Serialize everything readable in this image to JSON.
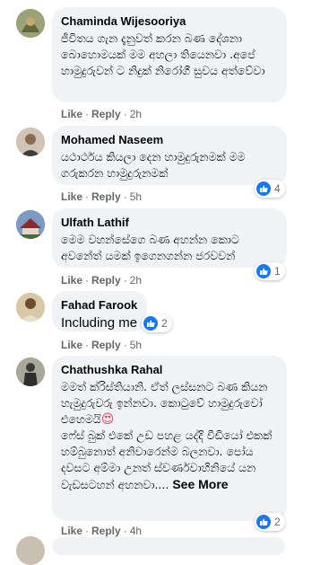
{
  "comments": [
    {
      "name": "Chaminda Wijesooriya",
      "text": "ජීවිතය ගැන දැනුවත් කරන බණ දේශනා බොහොමයක් මම අහලා තියෙනවා .අපේ හාමුදුරුවන් ට නිදුක් නිරෝගී සුවය අත්වේවා",
      "like": "Like",
      "reply": "Reply",
      "time": "2h",
      "reactions": ""
    },
    {
      "name": "Mohamed Naseem",
      "text": "යථාර්ථය කියලා දෙන හාමුදුරුනමක් මම ගරුකරන හාමුදුරුනමක්",
      "like": "Like",
      "reply": "Reply",
      "time": "5h",
      "reactions": "4"
    },
    {
      "name": "Ulfath Lathif",
      "text": "මෙම වහන්සේගෙ බණ අහන්න කොට අවනේත් යමක් ඉගෙනගන්න ජරවවන්",
      "like": "Like",
      "reply": "Reply",
      "time": "2h",
      "reactions": "1"
    },
    {
      "name": "Fahad Farook",
      "text": "Including me",
      "like": "Like",
      "reply": "Reply",
      "time": "5h",
      "reactions": "2"
    },
    {
      "name": "Chathushka Rahal",
      "text": "මමත් ක්රිස්තියානි. ඒත් ලස්සනට බණ කියන හැමුදුරුවරු ඉන්නවා. කොටුවේ හාමුදුරුවෝ එහෙමයි",
      "text2": "ෆේස් බුක් එකේ උඩ පහළ යද්දි වීඩියෝ එකක් හම්බුනොත් අනිවාරෙන්ම බලනවා. පෝය දවසට අම්මා උනත් ස්වර්ණවාහිනියේ යන වැඩසටහන් අහනවා....",
      "see_more": "See More",
      "like": "Like",
      "reply": "Reply",
      "time": "4h",
      "reactions": "2"
    }
  ],
  "colors": {
    "like_blue": "#1877f2",
    "bubble_bg": "#f0f2f5",
    "meta_grey": "#65676b"
  },
  "icons": {
    "like": "like-icon",
    "heart_eyes": "heart-eyes-emoji"
  }
}
